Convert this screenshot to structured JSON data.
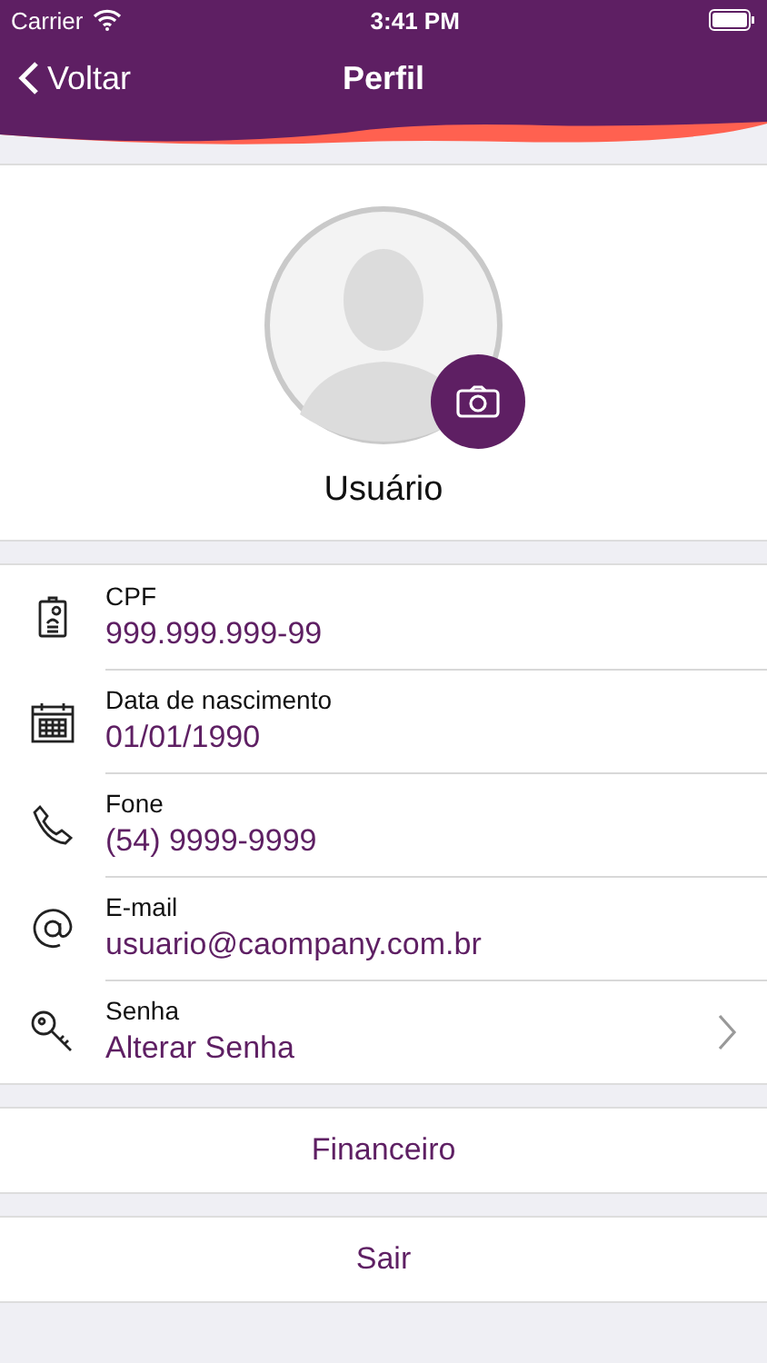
{
  "status_bar": {
    "carrier": "Carrier",
    "time": "3:41 PM"
  },
  "nav": {
    "back": "Voltar",
    "title": "Perfil"
  },
  "profile": {
    "name": "Usuário"
  },
  "fields": [
    {
      "kind": "id",
      "label": "CPF",
      "value": "999.999.999-99",
      "disclosure": false
    },
    {
      "kind": "calendar",
      "label": "Data de nascimento",
      "value": "01/01/1990",
      "disclosure": false
    },
    {
      "kind": "phone",
      "label": "Fone",
      "value": "(54) 9999-9999",
      "disclosure": false
    },
    {
      "kind": "email",
      "label": "E-mail",
      "value": "usuario@caompany.com.br",
      "disclosure": false
    },
    {
      "kind": "key",
      "label": "Senha",
      "value": "Alterar Senha",
      "disclosure": true
    }
  ],
  "buttons": [
    "Financeiro",
    "Sair"
  ]
}
